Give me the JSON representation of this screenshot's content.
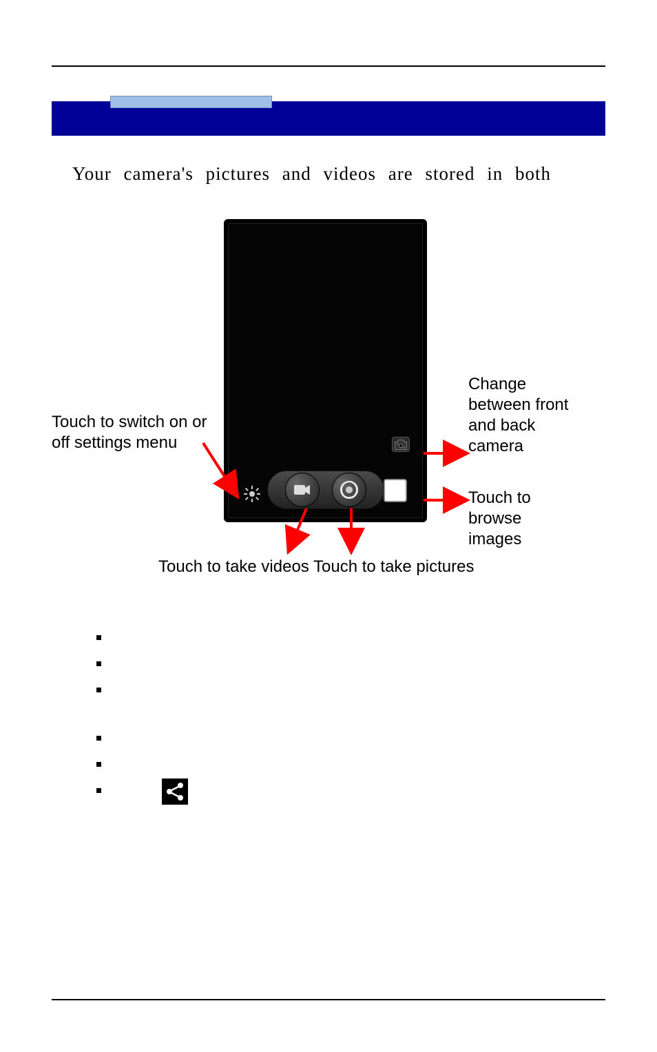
{
  "intro": "Your camera's pictures and videos are stored in both",
  "callouts": {
    "settings": "Touch to switch on or off settings menu",
    "change_camera": "Change between front and back camera",
    "browse": "Touch to browse images",
    "take_videos": "Touch to take videos",
    "take_pictures": "Touch to take pictures"
  },
  "icons": {
    "gear": "gear-icon",
    "video": "video-icon",
    "shutter": "shutter-icon",
    "switch_camera": "switch-camera-icon",
    "thumbnail": "thumbnail-icon",
    "share": "share-icon"
  },
  "colors": {
    "title_bar": "#000099",
    "arrow": "#ff0000"
  }
}
